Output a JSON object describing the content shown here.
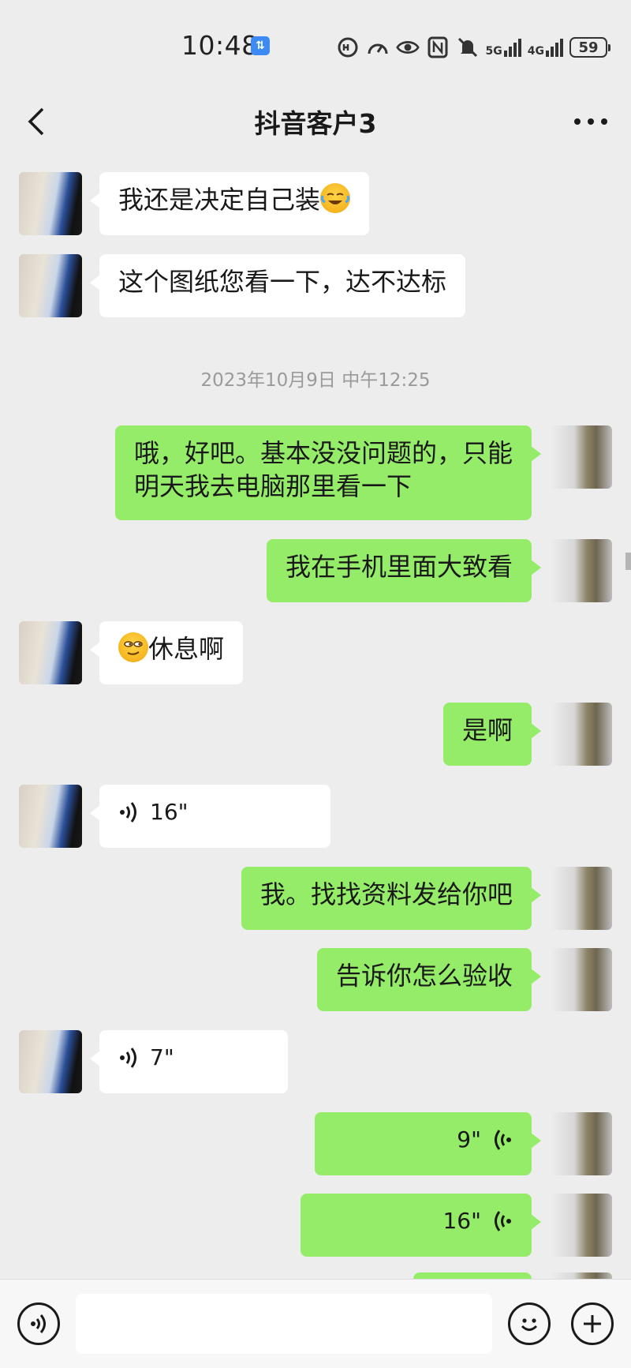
{
  "status_bar": {
    "time": "10:48",
    "sync_badge": "⇅",
    "net_5g": "5G",
    "net_4g": "4G",
    "battery": "59",
    "icons": [
      "hd-call-icon",
      "speed-icon",
      "eye-icon",
      "nfc-icon",
      "mute-icon",
      "signal-5g-icon",
      "signal-4g-icon",
      "battery-icon"
    ]
  },
  "header": {
    "title": "抖音客户3"
  },
  "messages": [
    {
      "side": "in",
      "text": "我还是决定自己装"
    },
    {
      "side": "in",
      "text": "这个图纸您看一下，达不达标"
    },
    {
      "type": "time",
      "text": "2023年10月9日 中午12:25"
    },
    {
      "side": "out",
      "line1": "哦，好吧。基本没没问题的，只能",
      "line2": "明天我去电脑那里看一下"
    },
    {
      "side": "out",
      "text": "我在手机里面大致看"
    },
    {
      "side": "in",
      "text": "休息啊"
    },
    {
      "side": "out",
      "text": "是啊"
    },
    {
      "side": "in",
      "type": "voice",
      "duration": "16\""
    },
    {
      "side": "out",
      "text": "我。找找资料发给你吧"
    },
    {
      "side": "out",
      "text": "告诉你怎么验收"
    },
    {
      "side": "in",
      "type": "voice",
      "duration": "7\""
    },
    {
      "side": "out",
      "type": "voice",
      "duration": "9\""
    },
    {
      "side": "out",
      "type": "voice",
      "duration": "16\""
    }
  ],
  "input_bar": {
    "placeholder": "",
    "value": ""
  },
  "colors": {
    "background": "#ededed",
    "bubble_out": "#95ec69",
    "bubble_in": "#ffffff",
    "input_bar": "#f7f7f7"
  }
}
